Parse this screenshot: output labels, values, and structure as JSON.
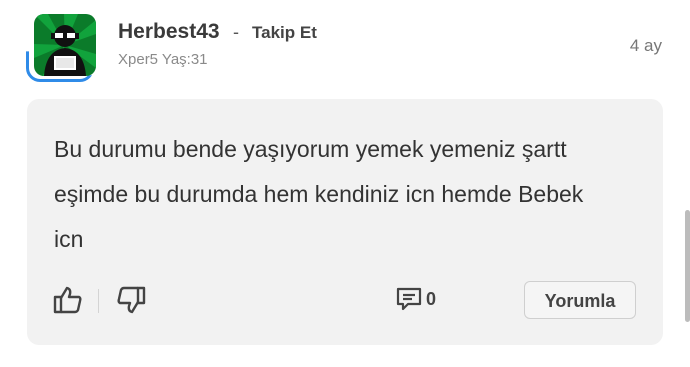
{
  "author": {
    "name": "Herbest43",
    "separator": "-",
    "follow_label": "Takip Et",
    "meta": "Xper5 Yaş:31"
  },
  "time_ago": "4 ay",
  "comment": {
    "text": "Bu durumu bende yaşıyorum yemek yemeniz şartt eşimde bu durumda hem kendiniz icn hemde Bebek icn"
  },
  "actions": {
    "comment_count": "0",
    "reply_label": "Yorumla"
  },
  "icons": {
    "like": "thumbs-up-icon",
    "dislike": "thumbs-down-icon",
    "comments": "comment-bubble-icon"
  },
  "colors": {
    "accent": "#2f8be8",
    "avatar_bg": "#0b7b2a",
    "card_bg": "#f2f2f2"
  }
}
